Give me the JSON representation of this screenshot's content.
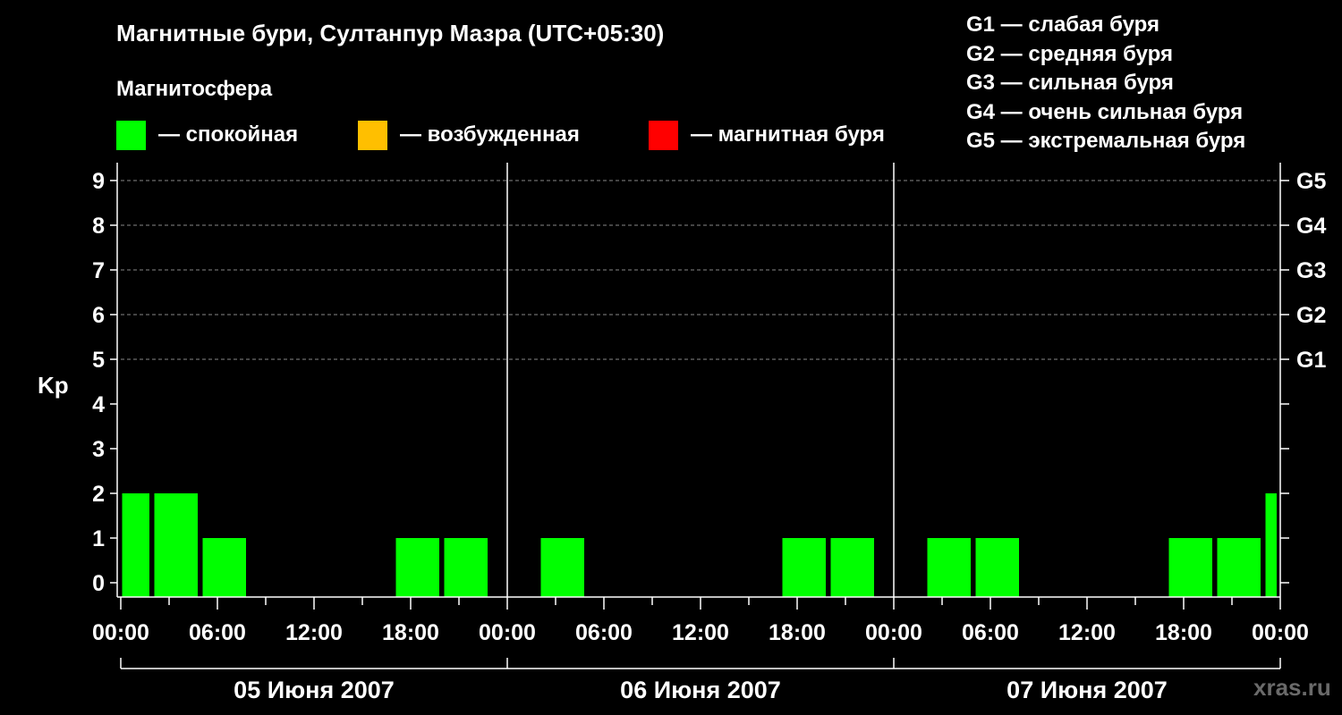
{
  "title": "Магнитные бури, Султанпур Мазра (UTC+05:30)",
  "subtitle": "Магнитосфера",
  "legend": [
    {
      "color": "#00ff00",
      "label": "— спокойная"
    },
    {
      "color": "#ffbf00",
      "label": "— возбужденная"
    },
    {
      "color": "#ff0000",
      "label": "— магнитная буря"
    }
  ],
  "storm_legend": [
    "G1 — слабая буря",
    "G2 — средняя буря",
    "G3 — сильная буря",
    "G4 — очень сильная буря",
    "G5 — экстремальная буря"
  ],
  "watermark": "xras.ru",
  "chart_data": {
    "type": "bar",
    "ylabel": "Kp",
    "ylim": [
      0,
      9
    ],
    "y_ticks": [
      "0",
      "1",
      "2",
      "3",
      "4",
      "5",
      "6",
      "7",
      "8",
      "9"
    ],
    "right_ticks": [
      {
        "kp": 5,
        "label": "G1"
      },
      {
        "kp": 6,
        "label": "G2"
      },
      {
        "kp": 7,
        "label": "G3"
      },
      {
        "kp": 8,
        "label": "G4"
      },
      {
        "kp": 9,
        "label": "G5"
      }
    ],
    "x_tick_labels": [
      "00:00",
      "06:00",
      "12:00",
      "18:00",
      "00:00",
      "06:00",
      "12:00",
      "18:00",
      "00:00",
      "06:00",
      "12:00",
      "18:00",
      "00:00"
    ],
    "days": [
      "05 Июня 2007",
      "06 Июня 2007",
      "07 Июня 2007"
    ],
    "grid": "dashed horizontal at Kp 5-9",
    "bars": [
      {
        "day": "05 Июня 2007",
        "start": "00:00",
        "end": "02:00",
        "kp": 2,
        "level": "спокойная"
      },
      {
        "day": "05 Июня 2007",
        "start": "02:00",
        "end": "05:00",
        "kp": 2,
        "level": "спокойная"
      },
      {
        "day": "05 Июня 2007",
        "start": "05:00",
        "end": "08:00",
        "kp": 1,
        "level": "спокойная"
      },
      {
        "day": "05 Июня 2007",
        "start": "08:00",
        "end": "11:00",
        "kp": 0,
        "level": "спокойная"
      },
      {
        "day": "05 Июня 2007",
        "start": "11:00",
        "end": "14:00",
        "kp": 0,
        "level": "спокойная"
      },
      {
        "day": "05 Июня 2007",
        "start": "14:00",
        "end": "17:00",
        "kp": 0,
        "level": "спокойная"
      },
      {
        "day": "05 Июня 2007",
        "start": "17:00",
        "end": "20:00",
        "kp": 1,
        "level": "спокойная"
      },
      {
        "day": "05 Июня 2007",
        "start": "20:00",
        "end": "23:00",
        "kp": 1,
        "level": "спокойная"
      },
      {
        "day": "06 Июня 2007",
        "start": "02:00",
        "end": "05:00",
        "kp": 1,
        "level": "спокойная"
      },
      {
        "day": "06 Июня 2007",
        "start": "17:00",
        "end": "20:00",
        "kp": 1,
        "level": "спокойная"
      },
      {
        "day": "06 Июня 2007",
        "start": "20:00",
        "end": "23:00",
        "kp": 1,
        "level": "спокойная"
      },
      {
        "day": "07 Июня 2007",
        "start": "02:00",
        "end": "05:00",
        "kp": 1,
        "level": "спокойная"
      },
      {
        "day": "07 Июня 2007",
        "start": "05:00",
        "end": "08:00",
        "kp": 1,
        "level": "спокойная"
      },
      {
        "day": "07 Июня 2007",
        "start": "17:00",
        "end": "20:00",
        "kp": 1,
        "level": "спокойная"
      },
      {
        "day": "07 Июня 2007",
        "start": "20:00",
        "end": "23:00",
        "kp": 1,
        "level": "спокойная"
      },
      {
        "day": "07 Июня 2007",
        "start": "23:00",
        "end": "24:00",
        "kp": 2,
        "level": "спокойная"
      }
    ]
  }
}
